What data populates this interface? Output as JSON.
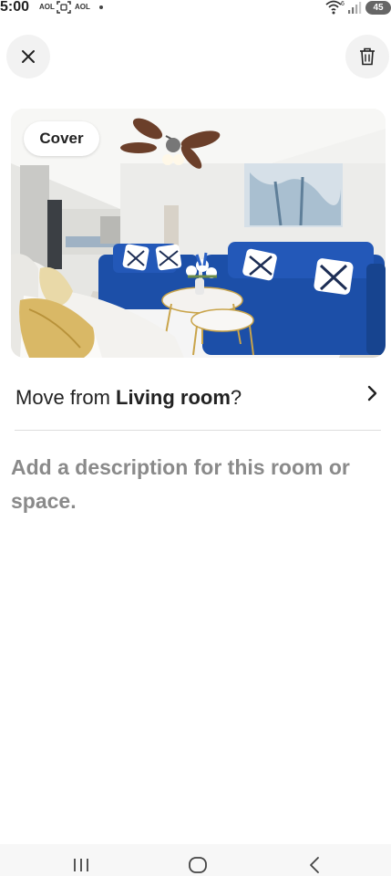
{
  "status_bar": {
    "time": "5:00",
    "notification_1": "AOL",
    "notification_2": "AOL",
    "wifi_badge": "6",
    "battery": "45"
  },
  "header": {
    "close_icon": "close-icon",
    "delete_icon": "trash-icon"
  },
  "photo": {
    "badge": "Cover",
    "subject": "living-room-photo"
  },
  "move": {
    "prefix": "Move from ",
    "room": "Living room",
    "suffix": "?"
  },
  "description": {
    "placeholder": "Add a description for this room or space."
  },
  "nav": {
    "recents_icon": "recents-icon",
    "home_icon": "home-icon",
    "back_icon": "back-icon"
  },
  "colors": {
    "sofa_blue": "#1c4fa8",
    "text": "#222222",
    "placeholder_gray": "#8a8a8a",
    "button_bg": "#f2f2f2"
  }
}
